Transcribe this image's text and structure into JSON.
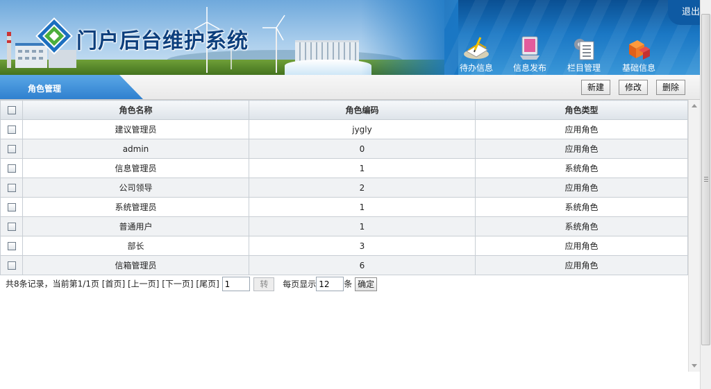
{
  "header": {
    "title": "门户后台维护系统",
    "logout_label": "退出",
    "nav": [
      {
        "label": "待办信息",
        "icon": "todo-notes-icon"
      },
      {
        "label": "信息发布",
        "icon": "publish-monitor-icon"
      },
      {
        "label": "栏目管理",
        "icon": "column-manage-icon"
      },
      {
        "label": "基础信息",
        "icon": "basic-info-boxes-icon"
      }
    ]
  },
  "toolbar": {
    "section_title": "角色管理",
    "new_label": "新建",
    "edit_label": "修改",
    "delete_label": "删除"
  },
  "table": {
    "columns": [
      "角色名称",
      "角色编码",
      "角色类型"
    ],
    "rows": [
      {
        "name": "建议管理员",
        "code": "jygly",
        "type": "应用角色"
      },
      {
        "name": "admin",
        "code": "0",
        "type": "应用角色"
      },
      {
        "name": "信息管理员",
        "code": "1",
        "type": "系统角色"
      },
      {
        "name": "公司领导",
        "code": "2",
        "type": "应用角色"
      },
      {
        "name": "系统管理员",
        "code": "1",
        "type": "系统角色"
      },
      {
        "name": "普通用户",
        "code": "1",
        "type": "系统角色"
      },
      {
        "name": "部长",
        "code": "3",
        "type": "应用角色"
      },
      {
        "name": "信箱管理员",
        "code": "6",
        "type": "应用角色"
      }
    ]
  },
  "pager": {
    "summary": "共8条记录，当前第1/1页",
    "first": "[首页]",
    "prev": "[上一页]",
    "next": "[下一页]",
    "last": "[尾页]",
    "page_value": "1",
    "go_label": "转",
    "per_page_prefix": "每页显示",
    "per_page_value": "12",
    "per_page_suffix": "条",
    "confirm_label": "确定"
  },
  "colors": {
    "header_blue": "#1a77c4",
    "tab_blue": "#3d8fd8",
    "title_navy": "#0d3f7d"
  }
}
